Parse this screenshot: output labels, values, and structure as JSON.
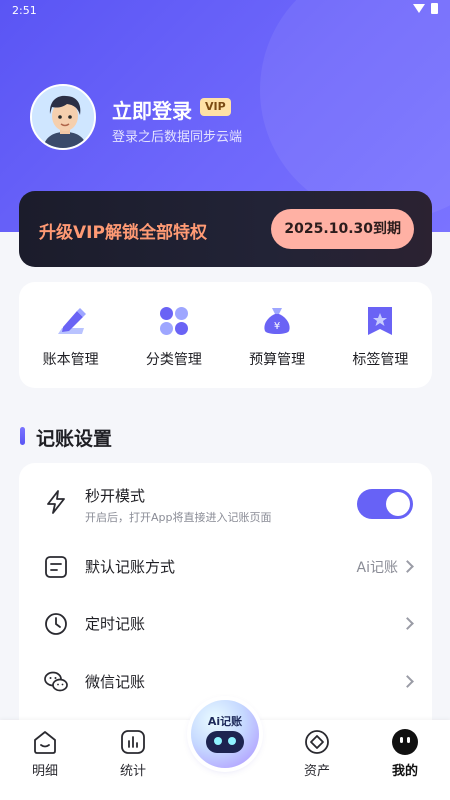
{
  "status_bar": {
    "time": "2:51"
  },
  "profile": {
    "title": "立即登录",
    "vip_badge": "VIP",
    "subtitle": "登录之后数据同步云端"
  },
  "vip_banner": {
    "title": "升级VIP解锁全部特权",
    "expire": "2025.10.30到期"
  },
  "quick_actions": [
    {
      "label": "账本管理",
      "icon": "ledger-edit-icon"
    },
    {
      "label": "分类管理",
      "icon": "category-grid-icon"
    },
    {
      "label": "预算管理",
      "icon": "money-bag-icon"
    },
    {
      "label": "标签管理",
      "icon": "bookmark-star-icon"
    }
  ],
  "section": {
    "title": "记账设置"
  },
  "settings": [
    {
      "title": "秒开模式",
      "desc": "开启后，打开App将直接进入记账页面",
      "icon": "lightning-icon",
      "toggle_on": true
    },
    {
      "title": "默认记账方式",
      "value": "Ai记账",
      "icon": "note-icon"
    },
    {
      "title": "定时记账",
      "icon": "clock-icon"
    },
    {
      "title": "微信记账",
      "icon": "wechat-icon"
    }
  ],
  "tabbar": {
    "items": [
      {
        "label": "明细",
        "icon": "home-icon"
      },
      {
        "label": "统计",
        "icon": "chart-icon"
      },
      {
        "label": "资产",
        "icon": "diamond-icon"
      },
      {
        "label": "我的",
        "icon": "face-icon",
        "active": true
      }
    ],
    "ai_button": "Ai记账"
  },
  "colors": {
    "accent": "#6762f6",
    "vip_text": "#ff9a74",
    "vip_pill": "#ffb1a4",
    "banner_bg": "#1b1c2b"
  }
}
